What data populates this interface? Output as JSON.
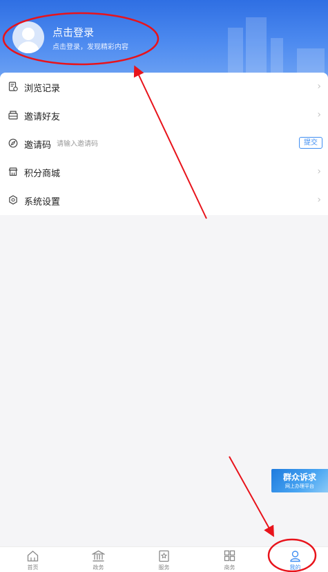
{
  "header": {
    "login_title": "点击登录",
    "login_subtitle": "点击登录，发现精彩内容"
  },
  "menu": {
    "history": "浏览记录",
    "invite_friends": "邀请好友",
    "invite_code": "邀请码",
    "invite_code_placeholder": "请输入邀请码",
    "submit": "提交",
    "points_mall": "积分商城",
    "settings": "系统设置"
  },
  "banner": {
    "title": "群众诉求",
    "subtitle": "网上办理平台"
  },
  "tabs": [
    {
      "label": "首页",
      "icon": "home-icon"
    },
    {
      "label": "政务",
      "icon": "government-icon"
    },
    {
      "label": "服务",
      "icon": "service-icon"
    },
    {
      "label": "商务",
      "icon": "business-icon"
    },
    {
      "label": "我的",
      "icon": "profile-icon"
    }
  ],
  "colors": {
    "accent": "#3f8ef2",
    "header_gradient_top": "#2f6fe3",
    "annotation_red": "#e8131b"
  }
}
